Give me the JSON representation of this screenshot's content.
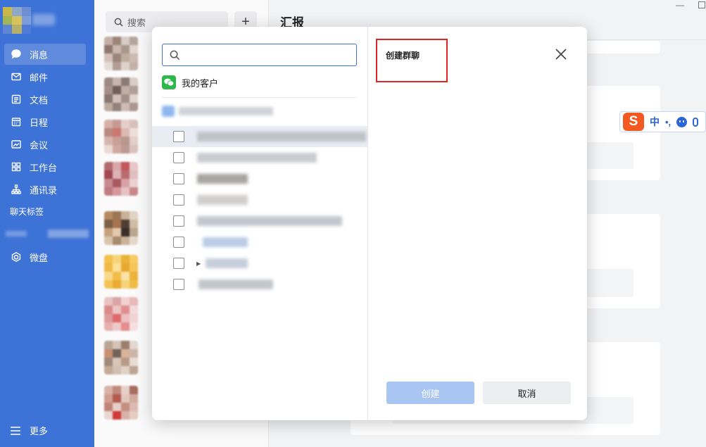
{
  "sidebar": {
    "items": [
      {
        "label": "消息",
        "icon": "chat-bubble-icon",
        "active": true
      },
      {
        "label": "邮件",
        "icon": "mail-icon"
      },
      {
        "label": "文档",
        "icon": "document-icon"
      },
      {
        "label": "日程",
        "icon": "calendar-icon"
      },
      {
        "label": "会议",
        "icon": "meeting-icon"
      },
      {
        "label": "工作台",
        "icon": "workbench-grid-icon"
      },
      {
        "label": "通讯录",
        "icon": "contacts-tree-icon"
      }
    ],
    "section_label": "聊天标签",
    "drive_label": "微盘",
    "more_label": "更多"
  },
  "conversation_list": {
    "search_placeholder": "搜索",
    "add_label": "+"
  },
  "workspace": {
    "title": "汇报"
  },
  "ime": {
    "logo": "S",
    "mode": "中",
    "punct": "•,"
  },
  "modal": {
    "search_value": "",
    "my_customers_label": "我的客户",
    "title": "创建群聊",
    "create_label": "创建",
    "cancel_label": "取消"
  },
  "colors": {
    "sidebar_bg": "#3d72d6",
    "primary": "#3d72d6",
    "create_disabled": "#a9c6f2",
    "highlight_box": "#e02424",
    "wechat_green": "#2db84a",
    "ime_orange": "#f25a22"
  }
}
